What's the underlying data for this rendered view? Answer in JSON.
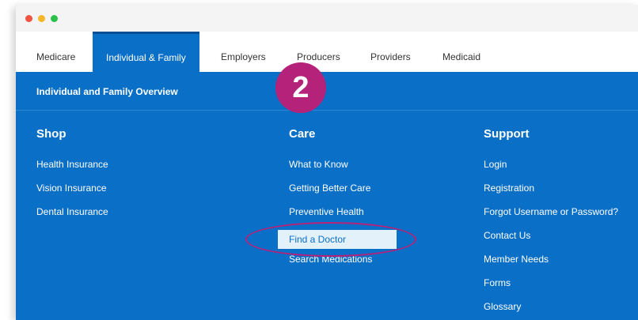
{
  "nav": {
    "tabs": [
      {
        "label": "Medicare"
      },
      {
        "label": "Individual & Family",
        "active": true
      },
      {
        "label": "Employers"
      },
      {
        "label": "Producers"
      },
      {
        "label": "Providers"
      },
      {
        "label": "Medicaid"
      }
    ]
  },
  "menu": {
    "overview": "Individual and Family Overview",
    "shop": {
      "title": "Shop",
      "items": [
        "Health Insurance",
        "Vision Insurance",
        "Dental Insurance"
      ]
    },
    "care": {
      "title": "Care",
      "items": [
        "What to Know",
        "Getting Better Care",
        "Preventive Health",
        "Find a Doctor",
        "Search Medications"
      ]
    },
    "support": {
      "title": "Support",
      "items": [
        "Login",
        "Registration",
        "Forgot Username or Password?",
        "Contact Us",
        "Member Needs",
        "Forms",
        "Glossary"
      ]
    }
  },
  "annotation": {
    "step": "2"
  },
  "colors": {
    "primary": "#0a6fc6",
    "highlight_bg": "#e3f1fb",
    "annotation": "#b5227a"
  }
}
